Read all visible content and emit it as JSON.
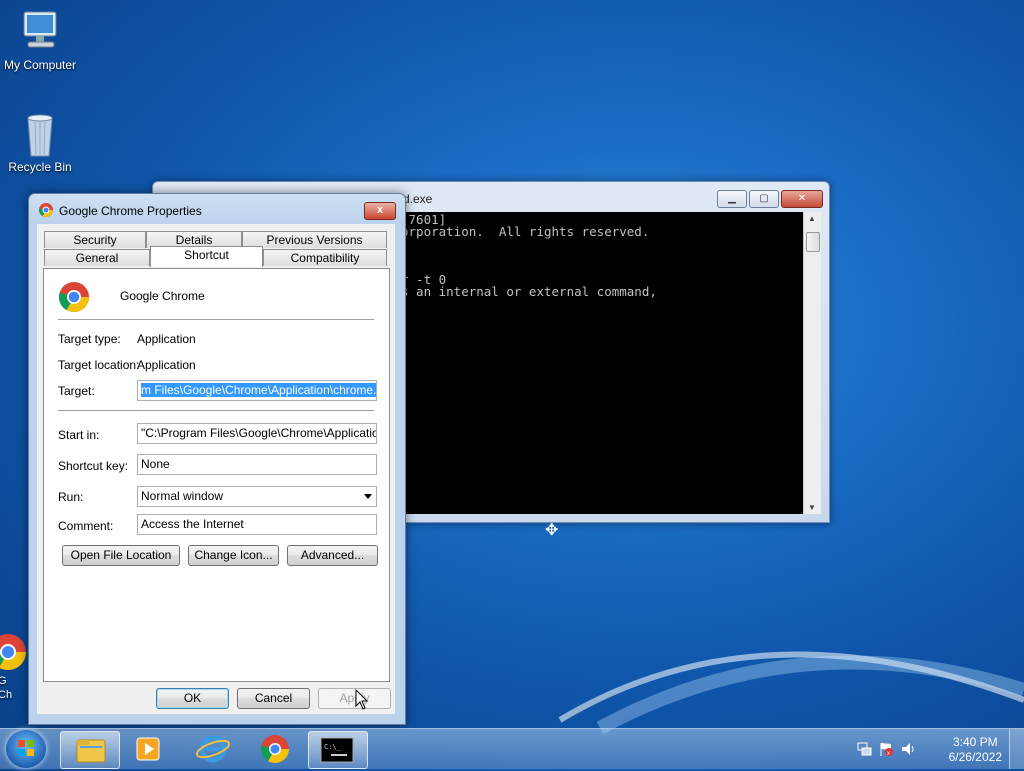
{
  "desktop": {
    "icons": [
      {
        "label": "My Computer"
      },
      {
        "label": "Recycle Bin"
      },
      {
        "label": "G\nCh"
      }
    ]
  },
  "console": {
    "title": "d.exe",
    "lines": [
      ".7601]",
      "orporation.  All rights reserved.",
      "",
      "",
      "",
      "r -t 0",
      "s an internal or external command,",
      "."
    ]
  },
  "dialog": {
    "title": "Google Chrome Properties",
    "close_label": "x",
    "tabs_row1": [
      "Security",
      "Details",
      "Previous Versions"
    ],
    "tabs_row2": [
      "General",
      "Shortcut",
      "Compatibility"
    ],
    "active_tab": "Shortcut",
    "app_name": "Google Chrome",
    "target_type_label": "Target type:",
    "target_type_value": "Application",
    "target_location_label": "Target location:",
    "target_location_value": "Application",
    "target_label": "Target:",
    "target_value": "m Files\\Google\\Chrome\\Application\\chrome.exe\"",
    "start_in_label": "Start in:",
    "start_in_value": "\"C:\\Program Files\\Google\\Chrome\\Application\"",
    "shortcut_key_label": "Shortcut key:",
    "shortcut_key_value": "None",
    "run_label": "Run:",
    "run_value": "Normal window",
    "comment_label": "Comment:",
    "comment_value": "Access the Internet",
    "open_file_location": "Open File Location",
    "change_icon": "Change Icon...",
    "advanced": "Advanced...",
    "ok": "OK",
    "cancel": "Cancel",
    "apply": "Apply"
  },
  "taskbar": {
    "apps": [
      "windows-explorer-icon",
      "media-player-icon",
      "internet-explorer-icon",
      "chrome-icon",
      "command-prompt-icon"
    ],
    "time": "3:40 PM",
    "date": "6/26/2022"
  },
  "colors": {
    "selection": "#3399ff",
    "console_bg": "#000000",
    "console_text": "#c0c0c0"
  }
}
